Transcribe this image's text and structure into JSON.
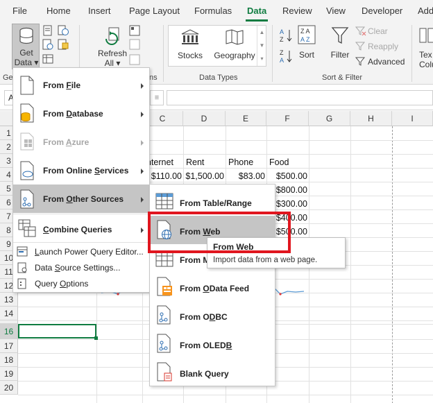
{
  "tabs": [
    "File",
    "Home",
    "Insert",
    "Page Layout",
    "Formulas",
    "Data",
    "Review",
    "View",
    "Developer",
    "Add"
  ],
  "active_tab": "Data",
  "ribbon": {
    "get_data": [
      "Get",
      "Data"
    ],
    "get_data_prefix": "Ge",
    "refresh_all": [
      "Refresh",
      "All"
    ],
    "queries_suffix": "ns",
    "stocks": "Stocks",
    "geography": "Geography",
    "data_types_label": "Data Types",
    "sort": "Sort",
    "filter": "Filter",
    "clear": "Clear",
    "reapply": "Reapply",
    "advanced": "Advanced",
    "sort_filter_label": "Sort & Filter",
    "text_to_columns": [
      "Tex",
      "Colu"
    ]
  },
  "formula_bar": {
    "name_box_fragment": "A"
  },
  "grid": {
    "columns": [
      "C",
      "D",
      "E",
      "F",
      "G",
      "H",
      "I"
    ],
    "rows": [
      "1",
      "2",
      "3",
      "4",
      "5",
      "6",
      "7",
      "8",
      "9",
      "10",
      "11",
      "12",
      "13",
      "14",
      "15",
      "16",
      "17",
      "18",
      "19",
      "20"
    ],
    "selected_row": "16",
    "header_row": [
      "nternet",
      "Rent",
      "Phone",
      "Food"
    ],
    "row4": [
      "$110.00",
      "$1,500.00",
      "$83.00",
      "$500.00"
    ],
    "food_column": [
      "$800.00",
      "$300.00",
      "$400.00",
      "$500.00"
    ]
  },
  "get_data_menu": {
    "items": [
      {
        "label": "From File",
        "key": "F",
        "submenu": true
      },
      {
        "label": "From Database",
        "key": "D",
        "submenu": true
      },
      {
        "label": "From Azure",
        "key": "A",
        "submenu": true,
        "disabled": true
      },
      {
        "label": "From Online Services",
        "key": "S",
        "submenu": true
      },
      {
        "label": "From Other Sources",
        "key": "O",
        "submenu": true,
        "highlighted": true
      },
      {
        "label": "Combine Queries",
        "key": "C",
        "submenu": true
      }
    ],
    "small_items": [
      {
        "label": "Launch Power Query Editor...",
        "key": "L"
      },
      {
        "label": "Data Source Settings...",
        "key": "S"
      },
      {
        "label": "Query Options",
        "key": "O"
      }
    ]
  },
  "other_sources_menu": {
    "items": [
      {
        "label": "From Table/Range"
      },
      {
        "label": "From Web",
        "highlighted": true
      },
      {
        "label": "From M"
      },
      {
        "label": "From OData Feed"
      },
      {
        "label": "From ODBC"
      },
      {
        "label": "From OLEDB"
      },
      {
        "label": "Blank Query"
      }
    ]
  },
  "tooltip": {
    "title": "From Web",
    "description": "Import data from a web page."
  },
  "colors": {
    "accent": "#107c41",
    "highlight_box": "#e0161f",
    "menu_highlight": "#c5c5c5"
  }
}
